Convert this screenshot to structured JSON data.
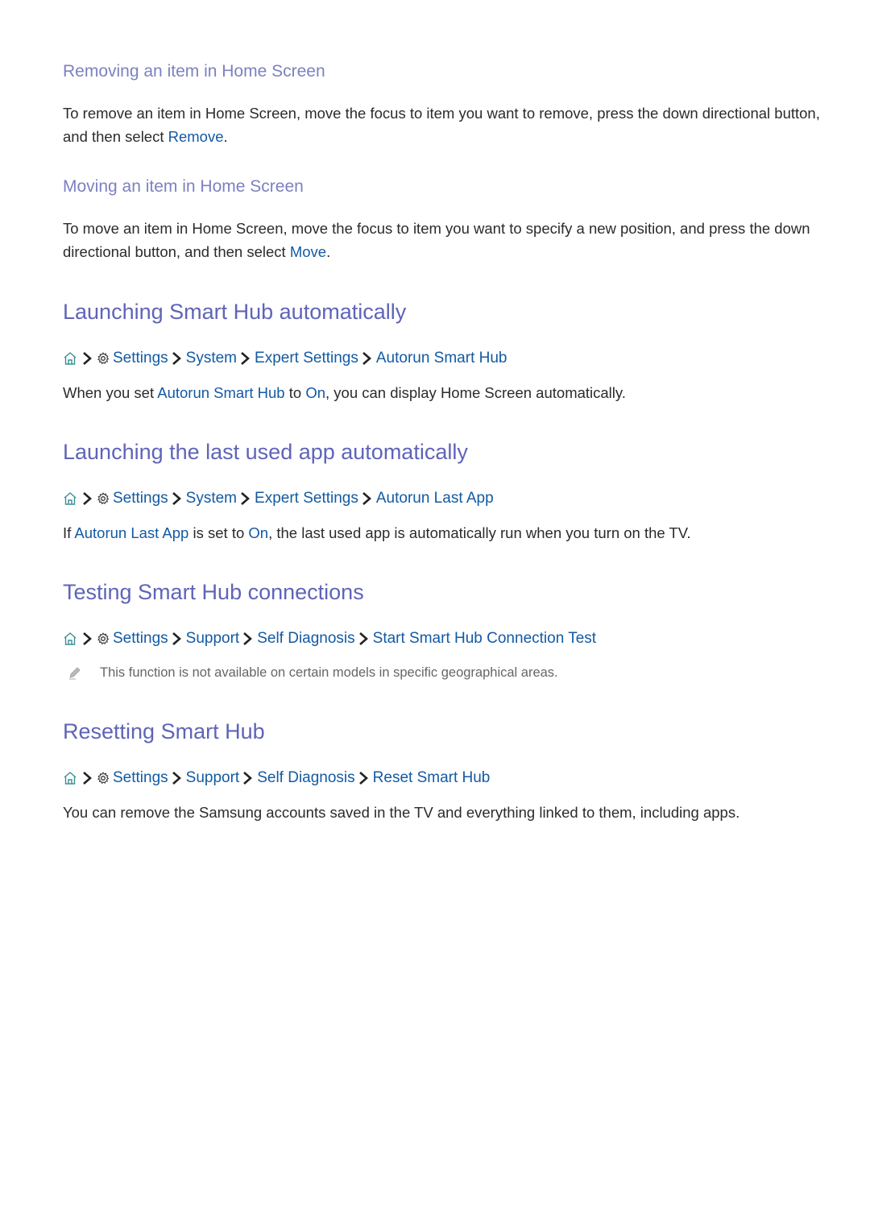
{
  "sections": [
    {
      "heading": "Removing an item in Home Screen",
      "body": {
        "pre": "To remove an item in Home Screen, move the focus to item you want to remove, press the down directional button, and then select ",
        "link": "Remove",
        "post": "."
      }
    },
    {
      "heading": "Moving an item in Home Screen",
      "body": {
        "pre": "To move an item in Home Screen, move the focus to item you want to specify a new position, and press the down directional button, and then select ",
        "link": "Move",
        "post": "."
      }
    },
    {
      "heading": "Launching Smart Hub automatically",
      "path": [
        "Settings",
        "System",
        "Expert Settings",
        "Autorun Smart Hub"
      ],
      "body": {
        "t1": "When you set ",
        "l1": "Autorun Smart Hub",
        "t2": " to ",
        "l2": "On",
        "t3": ", you can display Home Screen automatically."
      }
    },
    {
      "heading": "Launching the last used app automatically",
      "path": [
        "Settings",
        "System",
        "Expert Settings",
        "Autorun Last App"
      ],
      "body": {
        "t1": "If ",
        "l1": "Autorun Last App",
        "t2": " is set to ",
        "l2": "On",
        "t3": ", the last used app is automatically run when you turn on the TV."
      }
    },
    {
      "heading": "Testing Smart Hub connections",
      "path": [
        "Settings",
        "Support",
        "Self Diagnosis",
        "Start Smart Hub Connection Test"
      ],
      "note": "This function is not available on certain models in specific geographical areas."
    },
    {
      "heading": "Resetting Smart Hub",
      "path": [
        "Settings",
        "Support",
        "Self Diagnosis",
        "Reset Smart Hub"
      ],
      "body": {
        "text": "You can remove the Samsung accounts saved in the TV and everything linked to them, including apps."
      }
    }
  ],
  "icons": {
    "home": "home-icon",
    "gear": "gear-icon",
    "chevron": "chevron-right-icon",
    "note": "pencil-icon"
  },
  "colors": {
    "heading_small": "#7c81c0",
    "heading_large": "#5f64b8",
    "link": "#135aa3",
    "body": "#2b2b2b",
    "note": "#666666"
  }
}
